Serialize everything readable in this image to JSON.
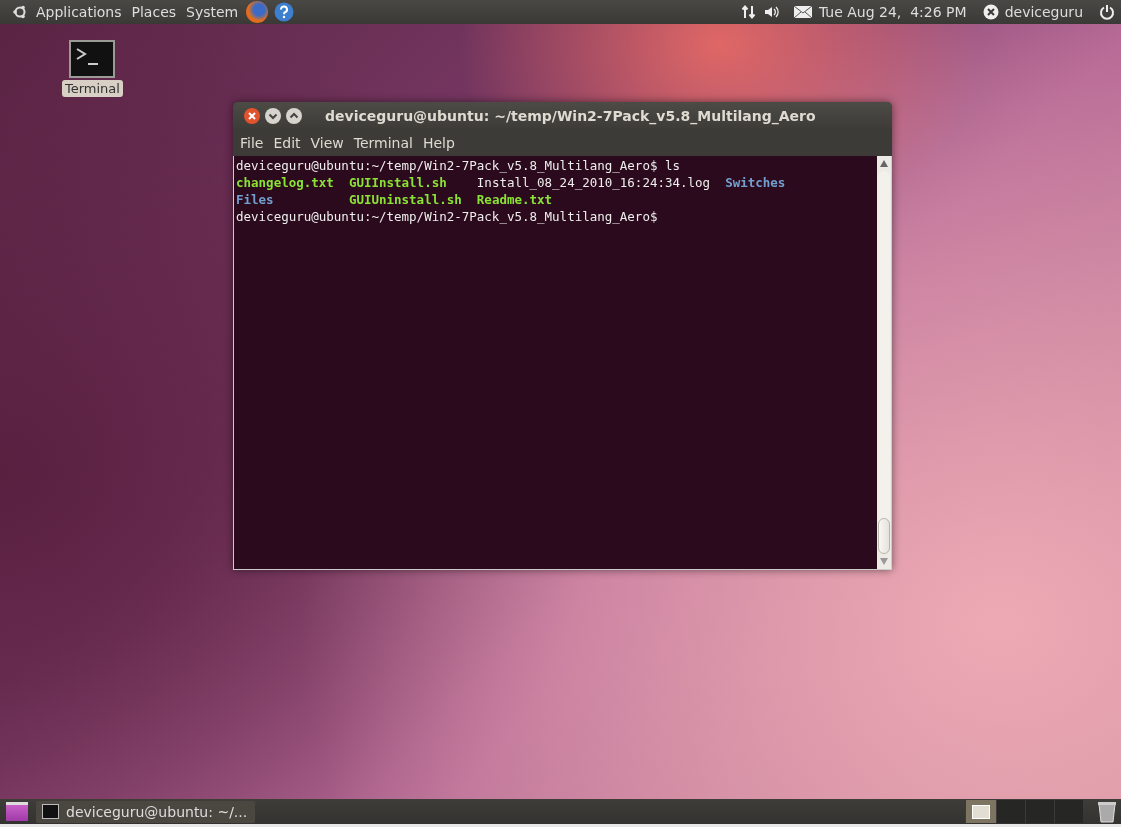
{
  "top_panel": {
    "menus": [
      "Applications",
      "Places",
      "System"
    ],
    "clock": "Tue Aug 24,  4:26 PM",
    "user": "deviceguru"
  },
  "desktop_icons": [
    {
      "label": "Terminal"
    }
  ],
  "terminal": {
    "title": "deviceguru@ubuntu: ~/temp/Win2-7Pack_v5.8_Multilang_Aero",
    "menus": [
      "File",
      "Edit",
      "View",
      "Terminal",
      "Help"
    ],
    "prompt_lines": [
      {
        "prompt": "deviceguru@ubuntu:~/temp/Win2-7Pack_v5.8_Multilang_Aero$",
        "command": "ls"
      }
    ],
    "listing": [
      [
        {
          "text": "changelog.txt",
          "kind": "exec"
        },
        {
          "text": "GUIInstall.sh",
          "kind": "exec"
        },
        {
          "text": "Install_08_24_2010_16:24:34.log",
          "kind": "plain"
        },
        {
          "text": "Switches",
          "kind": "dir"
        }
      ],
      [
        {
          "text": "Files",
          "kind": "dir"
        },
        {
          "text": "GUIUninstall.sh",
          "kind": "exec"
        },
        {
          "text": "Readme.txt",
          "kind": "exec"
        }
      ]
    ],
    "last_prompt": "deviceguru@ubuntu:~/temp/Win2-7Pack_v5.8_Multilang_Aero$"
  },
  "bottom_panel": {
    "tasks": [
      {
        "label": "deviceguru@ubuntu: ~/...",
        "selected": false
      }
    ],
    "workspaces": [
      {
        "selected": true
      },
      {
        "selected": false
      },
      {
        "selected": false
      },
      {
        "selected": false
      }
    ]
  }
}
